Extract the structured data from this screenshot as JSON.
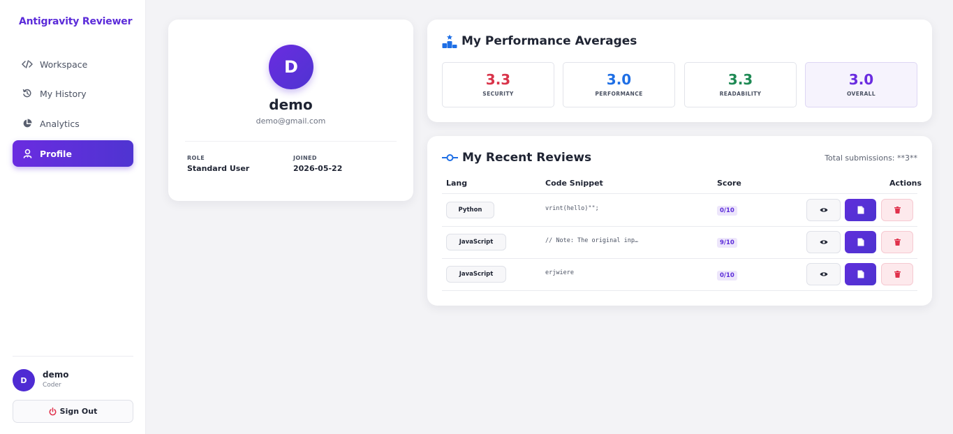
{
  "app": {
    "brand": "Antigravity Reviewer"
  },
  "sidebar": {
    "items": [
      {
        "label": "Workspace",
        "icon": "code-icon"
      },
      {
        "label": "My History",
        "icon": "history-icon"
      },
      {
        "label": "Analytics",
        "icon": "pie-chart-icon"
      },
      {
        "label": "Profile",
        "icon": "user-badge-icon",
        "active": true
      }
    ],
    "user": {
      "initial": "D",
      "name": "demo",
      "role": "Coder"
    },
    "signout_label": "Sign Out"
  },
  "profile": {
    "initial": "D",
    "name": "demo",
    "email": "demo@gmail.com",
    "role_label": "ROLE",
    "role_value": "Standard User",
    "joined_label": "JOINED",
    "joined_value": "2026-05-22"
  },
  "performance": {
    "title": "My Performance Averages",
    "stats": [
      {
        "value": "3.3",
        "label": "SECURITY",
        "color": "#d9344a"
      },
      {
        "value": "3.0",
        "label": "PERFORMANCE",
        "color": "#1f6fe5"
      },
      {
        "value": "3.3",
        "label": "READABILITY",
        "color": "#1f8a55"
      },
      {
        "value": "3.0",
        "label": "OVERALL",
        "color": "#6a2ce0"
      }
    ]
  },
  "reviews": {
    "title": "My Recent Reviews",
    "total": "Total submissions: **3**",
    "headers": {
      "lang": "Lang",
      "code": "Code Snippet",
      "score": "Score",
      "actions": "Actions"
    },
    "rows": [
      {
        "lang": "Python",
        "code": "vrint(hello)\"\";",
        "score": "0/10"
      },
      {
        "lang": "JavaScript",
        "code": "// Note: The original inp…",
        "score": "9/10"
      },
      {
        "lang": "JavaScript",
        "code": "erjwiere",
        "score": "0/10"
      }
    ]
  },
  "colors": {
    "accent": "#5b2bd9",
    "danger": "#e0314b"
  }
}
